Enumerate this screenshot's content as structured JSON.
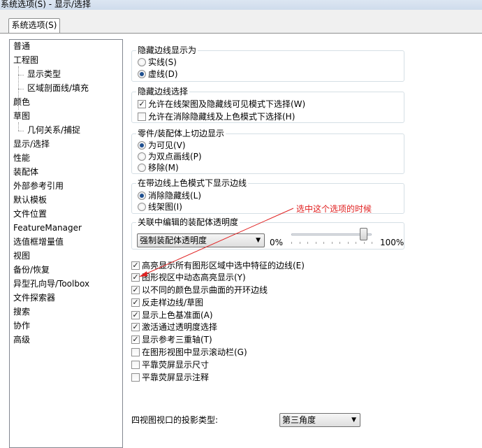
{
  "window": {
    "title": "系统选项(S) - 显示/选择"
  },
  "tabs": [
    {
      "label": "系统选项(S)"
    }
  ],
  "sidebar": {
    "items": [
      {
        "label": "普通",
        "level": 0
      },
      {
        "label": "工程图",
        "level": 0
      },
      {
        "label": "显示类型",
        "level": 1
      },
      {
        "label": "区域剖面线/填充",
        "level": 1
      },
      {
        "label": "颜色",
        "level": 0
      },
      {
        "label": "草图",
        "level": 0
      },
      {
        "label": "几何关系/捕捉",
        "level": 1
      },
      {
        "label": "显示/选择",
        "level": 0,
        "selected": true
      },
      {
        "label": "性能",
        "level": 0
      },
      {
        "label": "装配体",
        "level": 0
      },
      {
        "label": "外部参考引用",
        "level": 0
      },
      {
        "label": "默认模板",
        "level": 0
      },
      {
        "label": "文件位置",
        "level": 0
      },
      {
        "label": "FeatureManager",
        "level": 0
      },
      {
        "label": "选值框增量值",
        "level": 0
      },
      {
        "label": "视图",
        "level": 0
      },
      {
        "label": "备份/恢复",
        "level": 0
      },
      {
        "label": "异型孔向导/Toolbox",
        "level": 0
      },
      {
        "label": "文件探索器",
        "level": 0
      },
      {
        "label": "搜索",
        "level": 0
      },
      {
        "label": "协作",
        "level": 0
      },
      {
        "label": "高级",
        "level": 0
      }
    ]
  },
  "groups": {
    "hidden_edges_display": {
      "title": "隐藏边线显示为",
      "options": [
        {
          "label": "实线(S)",
          "checked": false
        },
        {
          "label": "虚线(D)",
          "checked": true
        }
      ]
    },
    "hidden_edges_select": {
      "title": "隐藏边线选择",
      "options": [
        {
          "label": "允许在线架图及隐藏线可见模式下选择(W)",
          "checked": true
        },
        {
          "label": "允许在消除隐藏线及上色模式下选择(H)",
          "checked": false
        }
      ]
    },
    "part_assembly_tangent": {
      "title": "零件/装配体上切边显示",
      "options": [
        {
          "label": "为可见(V)",
          "checked": true
        },
        {
          "label": "为双点画线(P)",
          "checked": false
        },
        {
          "label": "移除(M)",
          "checked": false
        }
      ]
    },
    "shaded_edges": {
      "title": "在带边线上色模式下显示边线",
      "options": [
        {
          "label": "消除隐藏线(L)",
          "checked": true
        },
        {
          "label": "线架图(I)",
          "checked": false
        }
      ]
    },
    "assembly_transparency": {
      "title": "关联中编辑的装配体透明度",
      "combo_value": "强制装配体透明度",
      "slider_min_label": "0%",
      "slider_max_label": "100%",
      "slider_value": 0.9
    }
  },
  "checkboxes": [
    {
      "label": "高亮显示所有图形区域中选中特征的边线(E)",
      "checked": true
    },
    {
      "label": "图形视区中动态高亮显示(Y)",
      "checked": true
    },
    {
      "label": "以不同的颜色显示曲面的开环边线",
      "checked": true
    },
    {
      "label": "反走样边线/草图",
      "checked": true
    },
    {
      "label": "显示上色基准面(A)",
      "checked": true
    },
    {
      "label": "激活通过透明度选择",
      "checked": true
    },
    {
      "label": "显示参考三重轴(T)",
      "checked": true
    },
    {
      "label": "在图形视图中显示滚动栏(G)",
      "checked": false
    },
    {
      "label": "平靠荧屏显示尺寸",
      "checked": false
    },
    {
      "label": "平靠荧屏显示注释",
      "checked": false
    }
  ],
  "projection": {
    "label": "四视图视口的投影类型:",
    "value": "第三角度"
  },
  "annotation": {
    "text": "选中这个选项的时候",
    "color": "#e02020"
  },
  "colors": {
    "accent": "#1e4f8f",
    "border": "#828790"
  }
}
